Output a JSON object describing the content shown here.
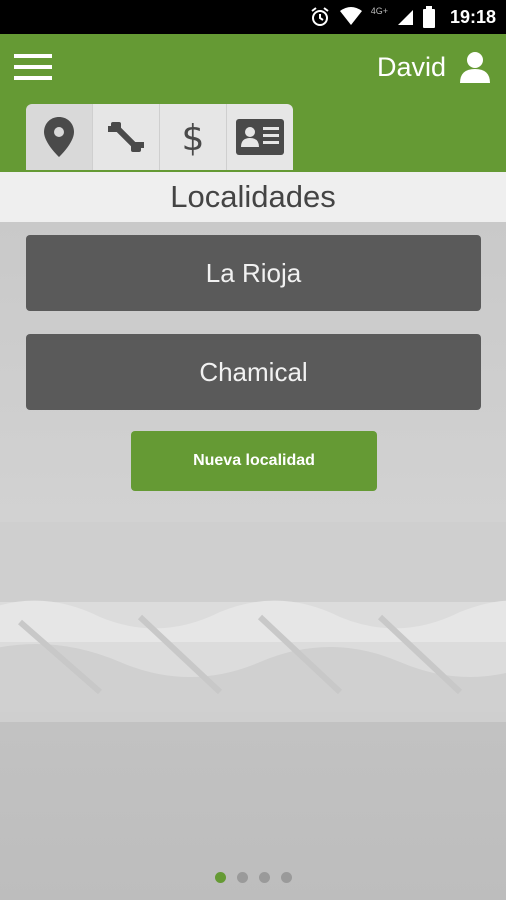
{
  "status_bar": {
    "time": "19:18",
    "network": "4G+",
    "icons": [
      "alarm-icon",
      "wifi-icon",
      "signal-icon",
      "battery-icon"
    ]
  },
  "header": {
    "username": "David",
    "menu_icon": "hamburger-menu-icon",
    "user_icon": "user-icon",
    "background_color": "#659a34"
  },
  "tabs": [
    {
      "icon": "location-pin-icon",
      "active": true
    },
    {
      "icon": "tools-icon",
      "active": false
    },
    {
      "icon": "dollar-icon",
      "active": false
    },
    {
      "icon": "id-card-icon",
      "active": false
    }
  ],
  "page": {
    "title": "Localidades"
  },
  "locations": [
    "La Rioja",
    "Chamical"
  ],
  "actions": {
    "new_location_label": "Nueva localidad"
  },
  "pager": {
    "count": 4,
    "active_index": 0
  }
}
